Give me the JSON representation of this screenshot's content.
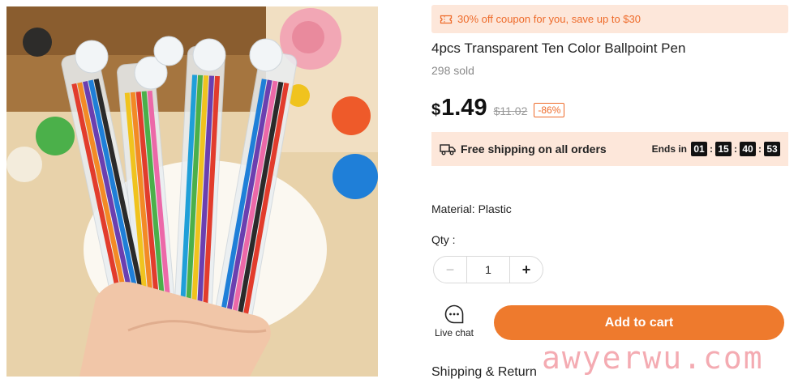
{
  "coupon": {
    "text": "30% off coupon for you, save up to $30",
    "icon": "coupon-ticket-icon"
  },
  "product": {
    "title": "4pcs Transparent Ten Color Ballpoint Pen",
    "sold": "298 sold",
    "currency": "$",
    "price": "1.49",
    "original_price": "$11.02",
    "discount": "-86%"
  },
  "shipping": {
    "icon": "truck-icon",
    "text": "Free shipping on all orders",
    "ends_label": "Ends in",
    "countdown": {
      "hours": "01",
      "minutes": "15",
      "seconds": "40",
      "centis": "53"
    }
  },
  "material": "Material: Plastic",
  "quantity": {
    "label": "Qty :",
    "value": "1",
    "minus": "−",
    "plus": "+"
  },
  "live_chat": {
    "label": "Live chat",
    "icon": "chat-bubble-icon"
  },
  "add_to_cart": "Add to cart",
  "shipping_return": "Shipping & Return",
  "watermark": "awyerwu.com",
  "colors": {
    "accent": "#ee7a2d",
    "accent_text": "#ee6b2a",
    "banner_bg": "#fde7da"
  }
}
